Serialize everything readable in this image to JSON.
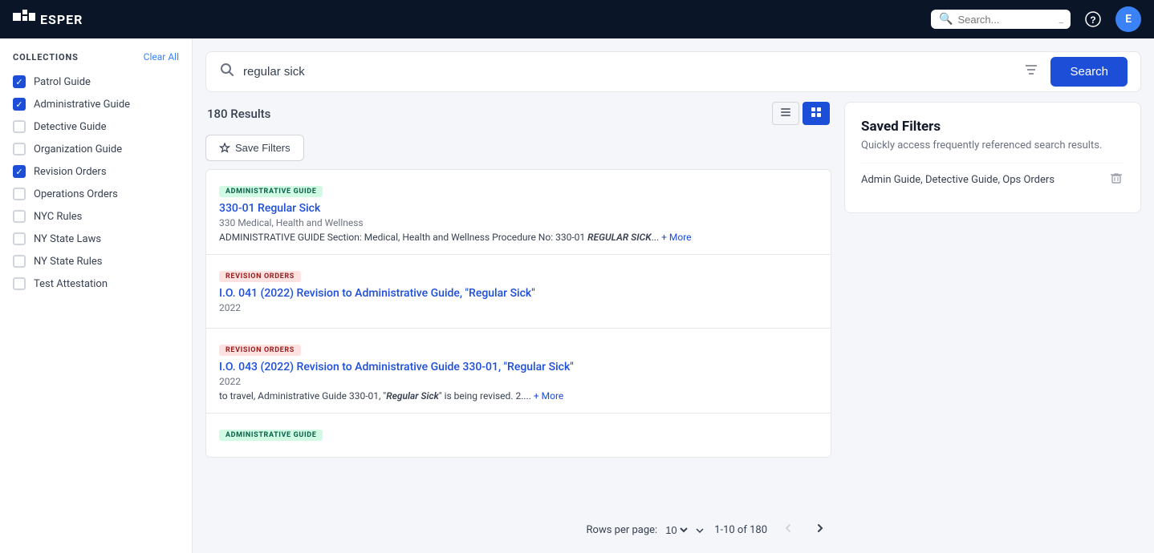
{
  "nav": {
    "logo_text": "ESPER",
    "search_placeholder": "Search...",
    "search_shortcut": "_",
    "help_icon": "?",
    "avatar_letter": "E"
  },
  "sidebar": {
    "section_title": "Collections",
    "clear_all_label": "Clear All",
    "items": [
      {
        "id": "patrol-guide",
        "label": "Patrol Guide",
        "checked": true
      },
      {
        "id": "administrative-guide",
        "label": "Administrative Guide",
        "checked": true
      },
      {
        "id": "detective-guide",
        "label": "Detective Guide",
        "checked": false
      },
      {
        "id": "organization-guide",
        "label": "Organization Guide",
        "checked": false
      },
      {
        "id": "revision-orders",
        "label": "Revision Orders",
        "checked": true
      },
      {
        "id": "operations-orders",
        "label": "Operations Orders",
        "checked": false
      },
      {
        "id": "nyc-rules",
        "label": "NYC Rules",
        "checked": false
      },
      {
        "id": "ny-state-laws",
        "label": "NY State Laws",
        "checked": false
      },
      {
        "id": "ny-state-rules",
        "label": "NY State Rules",
        "checked": false
      },
      {
        "id": "test-attestation",
        "label": "Test Attestation",
        "checked": false
      }
    ]
  },
  "search": {
    "query": "regular sick",
    "button_label": "Search",
    "filter_icon": "filter"
  },
  "results": {
    "count_label": "180 Results",
    "save_filters_label": "Save Filters",
    "view_list_icon": "list",
    "view_grid_icon": "grid",
    "items": [
      {
        "tag": "ADMINISTRATIVE GUIDE",
        "tag_type": "admin",
        "title": "330-01 Regular Sick",
        "subtitle": "330 Medical, Health and Wellness",
        "snippet": "ADMINISTRATIVE GUIDE Section: Medical, Health and Wellness Procedure No: 330-01 REGULAR SICK",
        "snippet_highlight": "REGULAR SICK",
        "has_more": true,
        "more_label": "+ More"
      },
      {
        "tag": "REVISION ORDERS",
        "tag_type": "revision",
        "title": "I.O. 041 (2022) Revision to Administrative Guide, \"Regular Sick\"",
        "subtitle": "2022",
        "snippet": "",
        "has_more": false,
        "more_label": ""
      },
      {
        "tag": "REVISION ORDERS",
        "tag_type": "revision",
        "title": "I.O. 043 (2022) Revision to Administrative Guide 330-01, \"Regular Sick\"",
        "subtitle": "2022",
        "snippet": "to travel, Administrative Guide 330-01, \"Regular Sick\" is being revised. 2....",
        "snippet_highlight": "Regular Sick",
        "has_more": true,
        "more_label": "+ More"
      },
      {
        "tag": "ADMINISTRATIVE GUIDE",
        "tag_type": "admin",
        "title": "",
        "subtitle": "",
        "snippet": "",
        "has_more": false,
        "more_label": ""
      }
    ],
    "pagination": {
      "rows_per_page_label": "Rows per page:",
      "rows_per_page_value": "10",
      "page_info": "1-10 of 180"
    }
  },
  "saved_filters": {
    "title": "Saved Filters",
    "description": "Quickly access frequently referenced search results.",
    "items": [
      {
        "name": "Admin Guide, Detective Guide, Ops Orders"
      }
    ]
  }
}
